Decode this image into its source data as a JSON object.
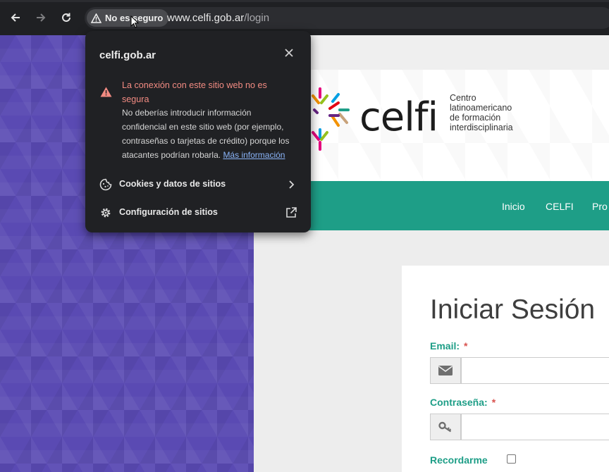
{
  "browser": {
    "security_chip_label": "No es seguro",
    "url_domain": "www.celfi.gob.ar",
    "url_path": "/login"
  },
  "popup": {
    "title": "celfi.gob.ar",
    "warning_heading": "La conexión con este sitio web no es segura",
    "warning_body": "No deberías introducir información confidencial en este sitio web (por ejemplo, contraseñas o tarjetas de crédito) porque los atacantes podrían robarla.",
    "more_info_link": "Más información",
    "rows": [
      {
        "label": "Cookies y datos de sitios",
        "icon": "cookie-icon",
        "trail_icon": "chevron-right-icon"
      },
      {
        "label": "Configuración de sitios",
        "icon": "gear-icon",
        "trail_icon": "open-external-icon"
      }
    ]
  },
  "site": {
    "logo_word": "celfi",
    "logo_tagline": [
      "Centro",
      "latinoamericano",
      "de formación",
      "interdisciplinaria"
    ],
    "nav_items": [
      "Inicio",
      "CELFI",
      "Pro"
    ],
    "login": {
      "title": "Iniciar Sesión",
      "email_label": "Email:",
      "password_label": "Contraseña:",
      "required_marker": "*",
      "remember_label": "Recordarme"
    }
  },
  "colors": {
    "accent_teal": "#1e9e87",
    "left_panel_purple": "#5a4ab3",
    "warning_red": "#f28b82",
    "link_blue": "#8ab4f8"
  }
}
